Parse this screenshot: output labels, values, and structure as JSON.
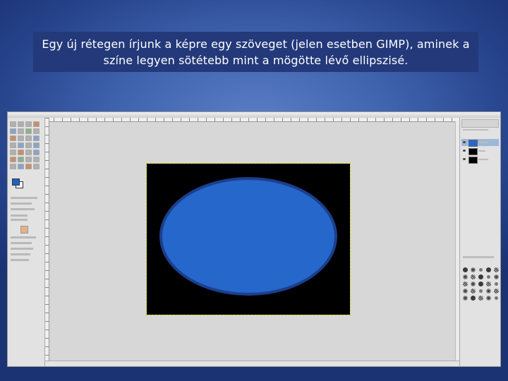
{
  "slide": {
    "caption": "Egy új rétegen írjunk a képre egy szöveget (jelen esetben GIMP), aminek a színe legyen sötétebb mint a mögötte lévő ellipszisé."
  },
  "gimp": {
    "colors": {
      "foreground": "#2061c8",
      "background": "#ffffff",
      "ellipse_fill": "#2667cc",
      "ellipse_border": "#1c3f8c",
      "image_background": "#000000"
    },
    "layers": [
      {
        "icon": "eye-icon",
        "thumb": "blue"
      },
      {
        "icon": "eye-icon",
        "thumb": "black"
      },
      {
        "icon": "eye-icon",
        "thumb": "black"
      }
    ]
  }
}
